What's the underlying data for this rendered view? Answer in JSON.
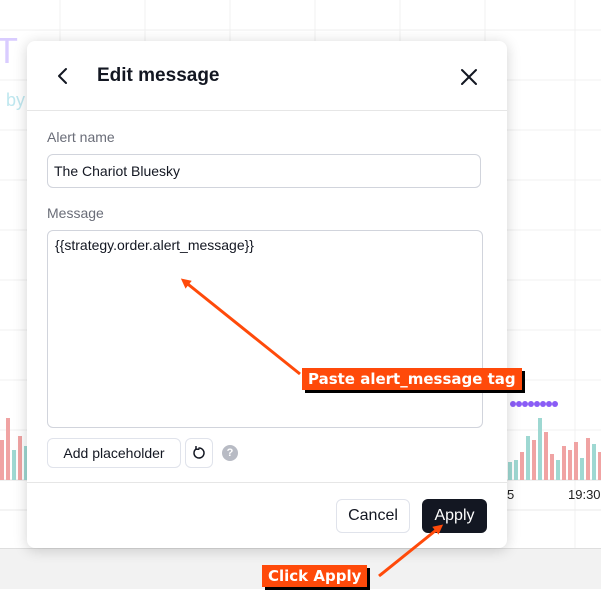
{
  "background": {
    "partial_title": "T",
    "partial_by": "by",
    "time_labels": [
      "5",
      "19:30"
    ]
  },
  "dialog": {
    "title": "Edit message",
    "back_icon": "chevron-left-icon",
    "close_icon": "close-icon",
    "alert_name_label": "Alert name",
    "alert_name_value": "The Chariot Bluesky",
    "message_label": "Message",
    "message_value": "{{strategy.order.alert_message}}",
    "add_placeholder_label": "Add placeholder",
    "reset_icon": "reset-icon",
    "help_icon_glyph": "?",
    "cancel_label": "Cancel",
    "apply_label": "Apply"
  },
  "annotations": {
    "paste_callout": "Paste alert_message tag",
    "apply_callout": "Click Apply",
    "color": "#ff4a0a"
  }
}
